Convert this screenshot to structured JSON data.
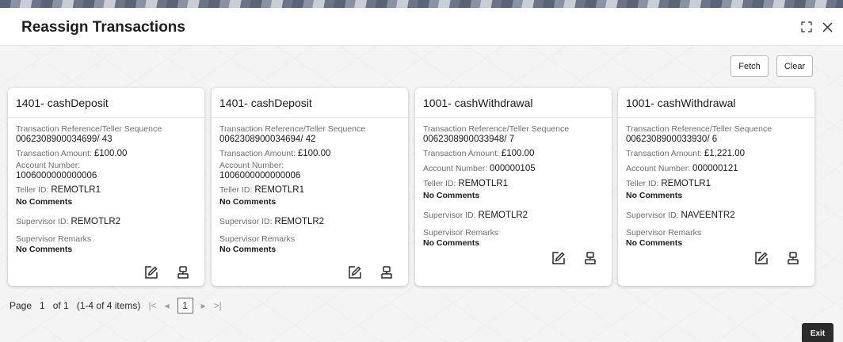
{
  "window": {
    "title": "Reassign Transactions"
  },
  "header_icons": {
    "maximize": "maximize-icon",
    "close": "close-icon"
  },
  "toolbar": {
    "fetch_label": "Fetch",
    "clear_label": "Clear"
  },
  "cards": [
    {
      "title": "1401- cashDeposit",
      "ref_label": "Transaction Reference/Teller Sequence",
      "ref_value": "0062308900034699/ 43",
      "amount_label": "Transaction Amount: ",
      "amount_value": "£100.00",
      "account_label": "Account Number:",
      "account_value": "1006000000000006",
      "teller_label": "Teller ID: ",
      "teller_value": "REMOTLR1",
      "comments": "No Comments",
      "supervisor_label": "Supervisor ID: ",
      "supervisor_value": "REMOTLR2",
      "remarks_label": "Supervisor Remarks",
      "remarks_value": "No Comments"
    },
    {
      "title": "1401- cashDeposit",
      "ref_label": "Transaction Reference/Teller Sequence",
      "ref_value": "0062308900034694/ 42",
      "amount_label": "Transaction Amount: ",
      "amount_value": "£100.00",
      "account_label": "Account Number:",
      "account_value": "1006000000000006",
      "teller_label": "Teller ID: ",
      "teller_value": "REMOTLR1",
      "comments": "No Comments",
      "supervisor_label": "Supervisor ID: ",
      "supervisor_value": "REMOTLR2",
      "remarks_label": "Supervisor Remarks",
      "remarks_value": "No Comments"
    },
    {
      "title": "1001- cashWithdrawal",
      "ref_label": "Transaction Reference/Teller Sequence",
      "ref_value": "0062308900033948/ 7",
      "amount_label": "Transaction Amount: ",
      "amount_value": "£100.00",
      "account_label": "Account Number: ",
      "account_value": "000000105",
      "teller_label": "Teller ID: ",
      "teller_value": "REMOTLR1",
      "comments": "No Comments",
      "supervisor_label": "Supervisor ID: ",
      "supervisor_value": "REMOTLR2",
      "remarks_label": "Supervisor Remarks",
      "remarks_value": "No Comments"
    },
    {
      "title": "1001- cashWithdrawal",
      "ref_label": "Transaction Reference/Teller Sequence",
      "ref_value": "0062308900033930/ 6",
      "amount_label": "Transaction Amount: ",
      "amount_value": "£1,221.00",
      "account_label": "Account Number: ",
      "account_value": "000000121",
      "teller_label": "Teller ID: ",
      "teller_value": "REMOTLR1",
      "comments": "No Comments",
      "supervisor_label": "Supervisor ID: ",
      "supervisor_value": "NAVEENTR2",
      "remarks_label": "Supervisor Remarks",
      "remarks_value": "No Comments"
    }
  ],
  "card_icons": {
    "edit": "edit-icon",
    "assign": "teller-assign-icon"
  },
  "pagination": {
    "page_label": "Page",
    "current_page": "1",
    "of_total": "of 1",
    "items_summary": "(1-4 of 4 items)",
    "first": "|<",
    "prev": "◂",
    "page_button": "1",
    "next": "▸",
    "last": ">|"
  },
  "footer": {
    "exit_label": "Exit"
  }
}
